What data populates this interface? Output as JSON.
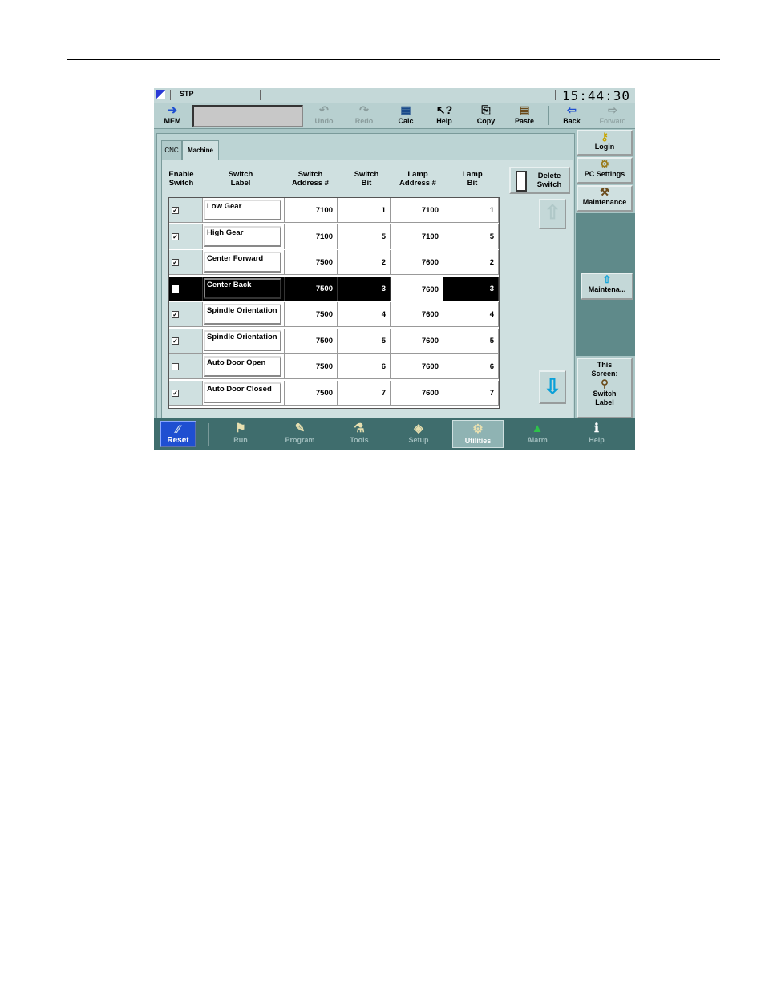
{
  "status": {
    "mode": "STP",
    "clock": "15:44:30"
  },
  "toolbar": {
    "mem": "MEM",
    "undo": "Undo",
    "redo": "Redo",
    "calc": "Calc",
    "help": "Help",
    "copy": "Copy",
    "paste": "Paste",
    "back": "Back",
    "forward": "Forward"
  },
  "tabs": [
    "CNC",
    "Machine"
  ],
  "columns": {
    "enable": [
      "Enable",
      "Switch"
    ],
    "label": [
      "Switch",
      "Label"
    ],
    "address": [
      "Switch",
      "Address #"
    ],
    "bit": [
      "Switch",
      "Bit"
    ],
    "lamp_address": [
      "Lamp",
      "Address #"
    ],
    "lamp_bit": [
      "Lamp",
      "Bit"
    ]
  },
  "rows": [
    {
      "enabled": true,
      "label": "Low Gear",
      "address": "7100",
      "bit": "1",
      "lamp_address": "7100",
      "lamp_bit": "1"
    },
    {
      "enabled": true,
      "label": "High Gear",
      "address": "7100",
      "bit": "5",
      "lamp_address": "7100",
      "lamp_bit": "5"
    },
    {
      "enabled": true,
      "label": "Center Forward",
      "address": "7500",
      "bit": "2",
      "lamp_address": "7600",
      "lamp_bit": "2"
    },
    {
      "enabled": false,
      "label": "Center Back",
      "address": "7500",
      "bit": "3",
      "lamp_address": "7600",
      "lamp_bit": "3"
    },
    {
      "enabled": true,
      "label": "Spindle Orientation",
      "address": "7500",
      "bit": "4",
      "lamp_address": "7600",
      "lamp_bit": "4"
    },
    {
      "enabled": true,
      "label": "Spindle Orientation",
      "address": "7500",
      "bit": "5",
      "lamp_address": "7600",
      "lamp_bit": "5"
    },
    {
      "enabled": false,
      "label": "Auto Door Open",
      "address": "7500",
      "bit": "6",
      "lamp_address": "7600",
      "lamp_bit": "6"
    },
    {
      "enabled": true,
      "label": "Auto Door Closed",
      "address": "7500",
      "bit": "7",
      "lamp_address": "7600",
      "lamp_bit": "7"
    }
  ],
  "selected_row": 3,
  "delete_switch": [
    "Delete",
    "Switch"
  ],
  "sidebar": {
    "login": "Login",
    "pc_settings": "PC Settings",
    "maintenance": "Maintenance",
    "maintena_btn": "Maintena...",
    "this_screen": [
      "This",
      "Screen:"
    ],
    "switch_label": [
      "Switch",
      "Label"
    ]
  },
  "nav": {
    "reset": "Reset",
    "items": [
      "Run",
      "Program",
      "Tools",
      "Setup",
      "Utilities",
      "Alarm",
      "Help"
    ],
    "active": "Utilities"
  }
}
